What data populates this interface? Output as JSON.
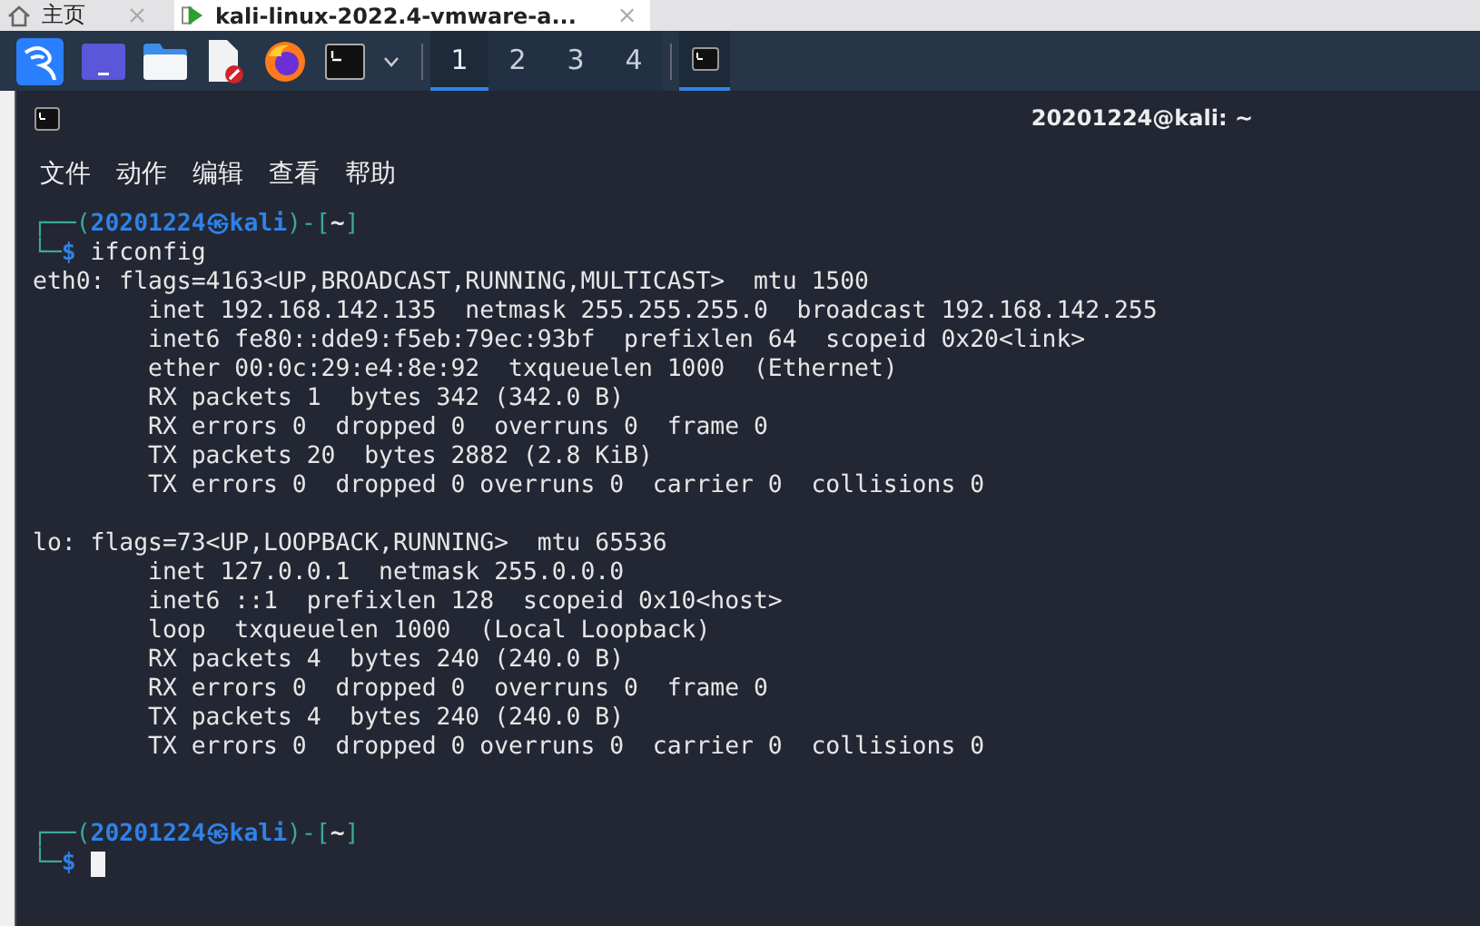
{
  "browser_tabs": [
    {
      "label": "主页",
      "selected": false
    },
    {
      "label": "kali-linux-2022.4-vmware-a...",
      "selected": true
    }
  ],
  "taskbar": {
    "workspaces": [
      {
        "label": "1",
        "selected": true
      },
      {
        "label": "2",
        "selected": false
      },
      {
        "label": "3",
        "selected": false
      },
      {
        "label": "4",
        "selected": false
      }
    ],
    "windows": [
      {
        "selected": true
      }
    ]
  },
  "terminal": {
    "title": "20201224@kali: ~",
    "menu": [
      "文件",
      "动作",
      "编辑",
      "查看",
      "帮助"
    ],
    "lines": [
      {
        "kind": "prompt",
        "top": "┌──(",
        "user": "20201224",
        "at": "㉿",
        "host": "kali",
        "sep": ")-[",
        "dir": "~",
        "close": "]",
        "corner": "└─",
        "symbol": "$",
        "command": "ifconfig",
        "cursor": false
      },
      {
        "kind": "output",
        "text": "eth0: flags=4163<UP,BROADCAST,RUNNING,MULTICAST>  mtu 1500"
      },
      {
        "kind": "output",
        "text": "        inet 192.168.142.135  netmask 255.255.255.0  broadcast 192.168.142.255"
      },
      {
        "kind": "output",
        "text": "        inet6 fe80::dde9:f5eb:79ec:93bf  prefixlen 64  scopeid 0x20<link>"
      },
      {
        "kind": "output",
        "text": "        ether 00:0c:29:e4:8e:92  txqueuelen 1000  (Ethernet)"
      },
      {
        "kind": "output",
        "text": "        RX packets 1  bytes 342 (342.0 B)"
      },
      {
        "kind": "output",
        "text": "        RX errors 0  dropped 0  overruns 0  frame 0"
      },
      {
        "kind": "output",
        "text": "        TX packets 20  bytes 2882 (2.8 KiB)"
      },
      {
        "kind": "output",
        "text": "        TX errors 0  dropped 0 overruns 0  carrier 0  collisions 0"
      },
      {
        "kind": "blank"
      },
      {
        "kind": "output",
        "text": "lo: flags=73<UP,LOOPBACK,RUNNING>  mtu 65536"
      },
      {
        "kind": "output",
        "text": "        inet 127.0.0.1  netmask 255.0.0.0"
      },
      {
        "kind": "output",
        "text": "        inet6 ::1  prefixlen 128  scopeid 0x10<host>"
      },
      {
        "kind": "output",
        "text": "        loop  txqueuelen 1000  (Local Loopback)"
      },
      {
        "kind": "output",
        "text": "        RX packets 4  bytes 240 (240.0 B)"
      },
      {
        "kind": "output",
        "text": "        RX errors 0  dropped 0  overruns 0  frame 0"
      },
      {
        "kind": "output",
        "text": "        TX packets 4  bytes 240 (240.0 B)"
      },
      {
        "kind": "output",
        "text": "        TX errors 0  dropped 0 overruns 0  carrier 0  collisions 0"
      },
      {
        "kind": "blank"
      },
      {
        "kind": "blank"
      },
      {
        "kind": "prompt",
        "top": "┌──(",
        "user": "20201224",
        "at": "㉿",
        "host": "kali",
        "sep": ")-[",
        "dir": "~",
        "close": "]",
        "corner": "└─",
        "symbol": "$",
        "cursor": true
      }
    ]
  }
}
